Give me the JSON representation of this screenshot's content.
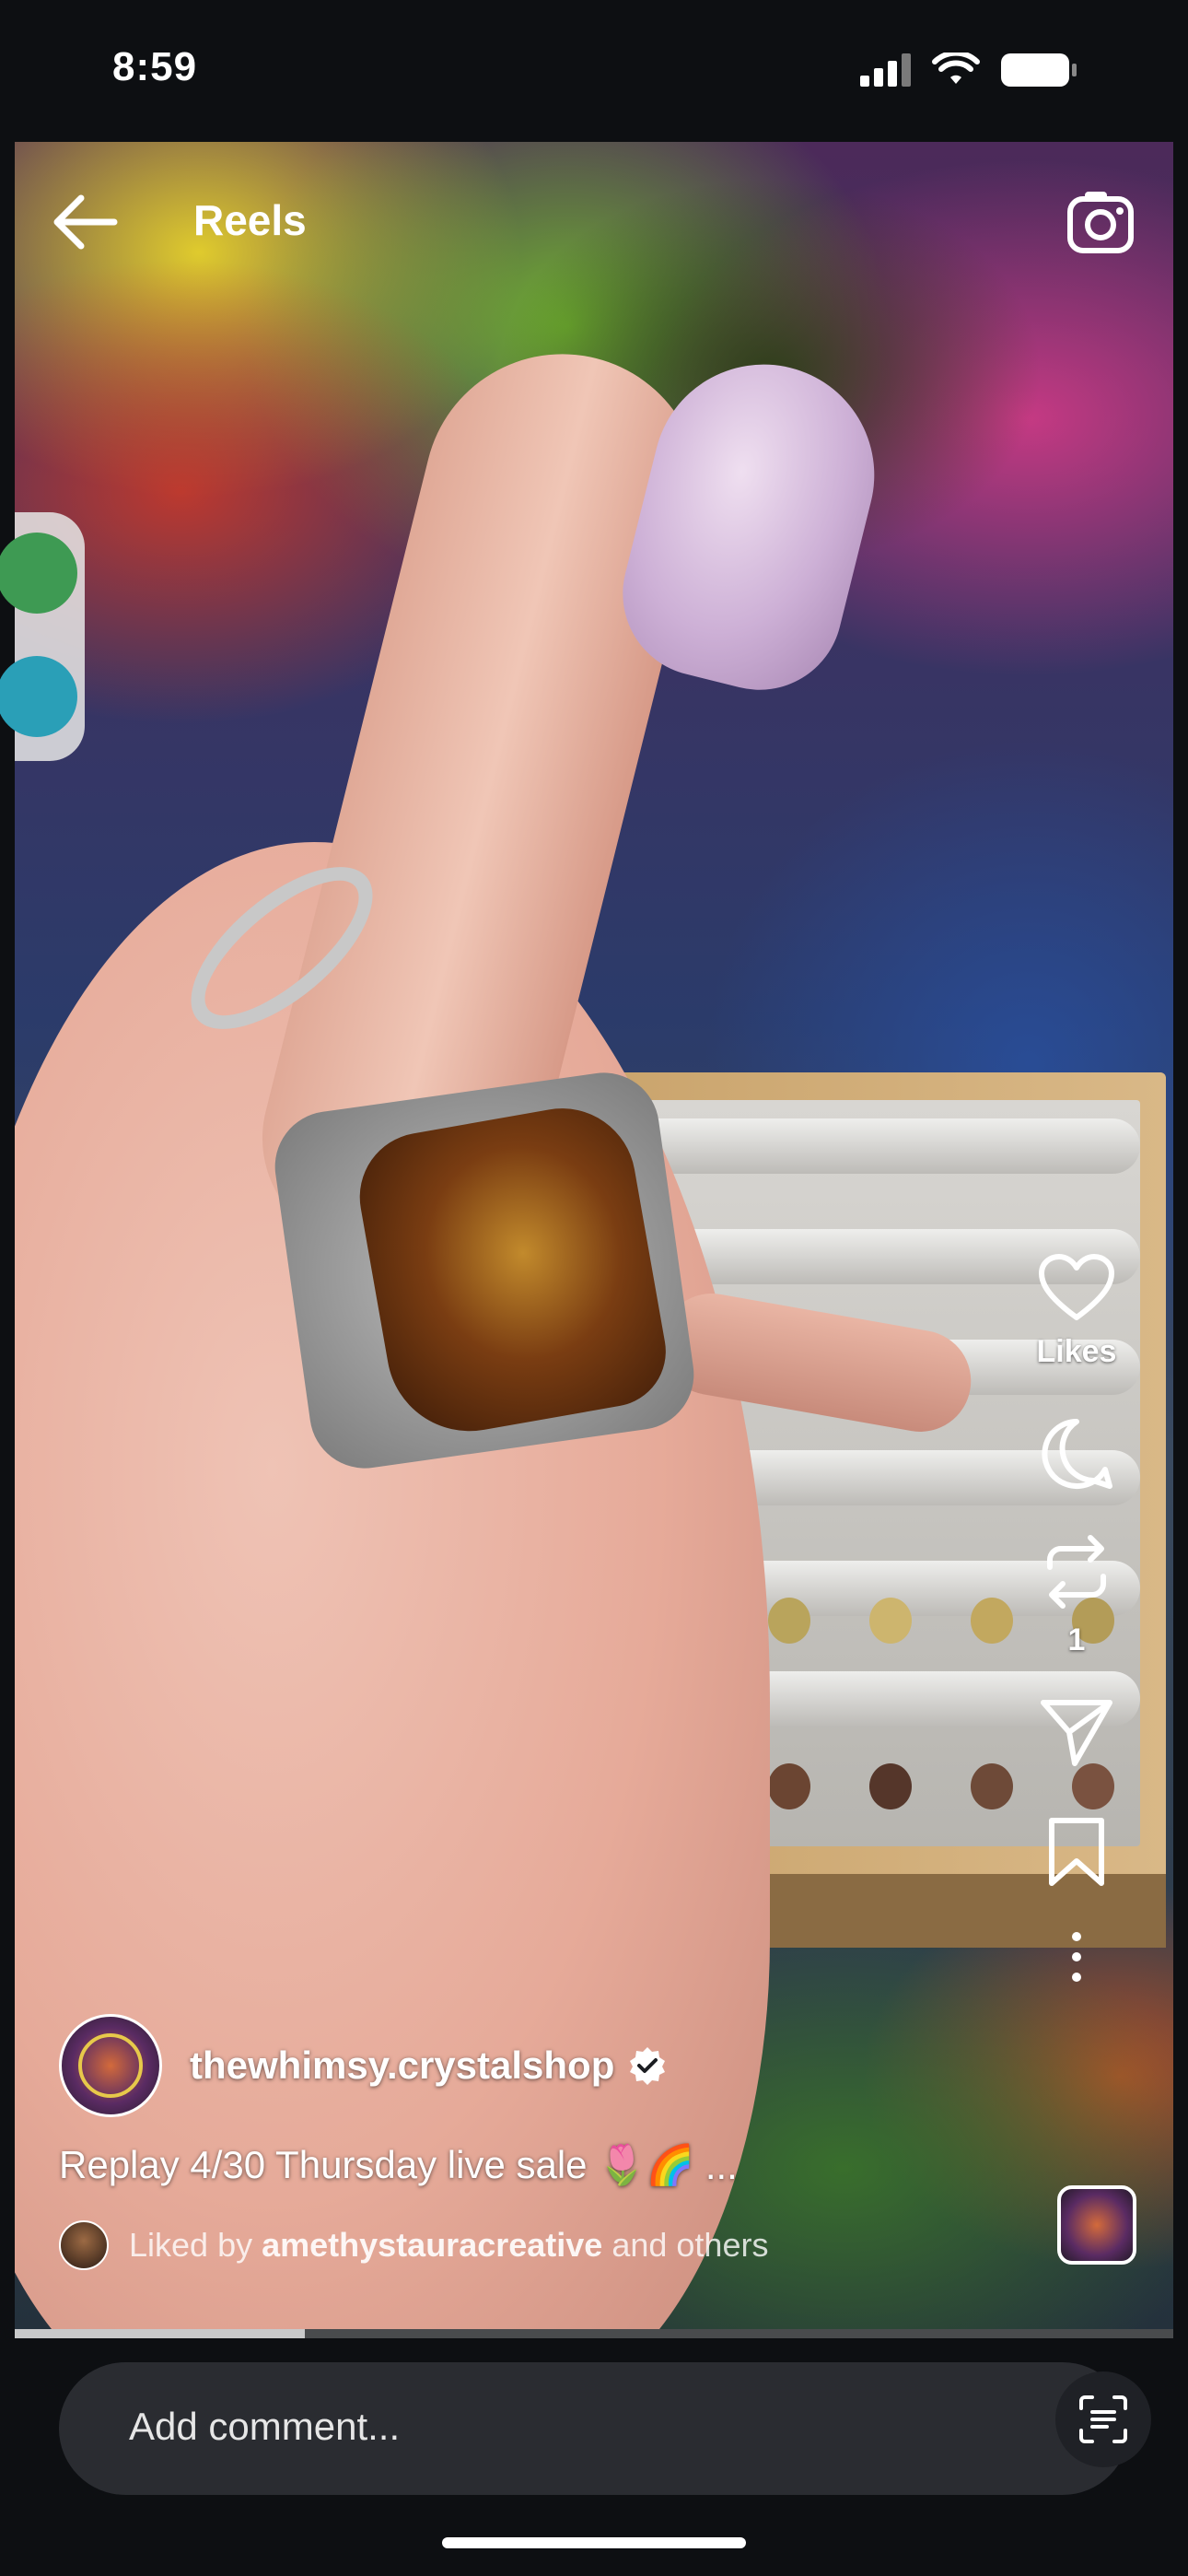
{
  "status_bar": {
    "time": "8:59"
  },
  "header": {
    "title": "Reels"
  },
  "actions": {
    "likes_label": "Likes",
    "reposts_count": "1"
  },
  "post": {
    "username": "thewhimsy.crystalshop",
    "verified": true,
    "caption": "Replay 4/30 Thursday live sale 🌷🌈",
    "caption_more": "...",
    "liked_by_prefix": "Liked by",
    "liked_by_user": "amethystauracreative",
    "liked_by_suffix": "and others"
  },
  "video": {
    "progress_fraction": 0.25
  },
  "comment": {
    "placeholder": "Add comment..."
  },
  "icons": {
    "back": "back-arrow-icon",
    "camera": "camera-icon",
    "like": "heart-icon",
    "comment": "comment-icon",
    "repost": "repost-icon",
    "share": "send-icon",
    "save": "bookmark-icon",
    "more": "more-vertical-icon",
    "scan": "scan-text-icon"
  }
}
